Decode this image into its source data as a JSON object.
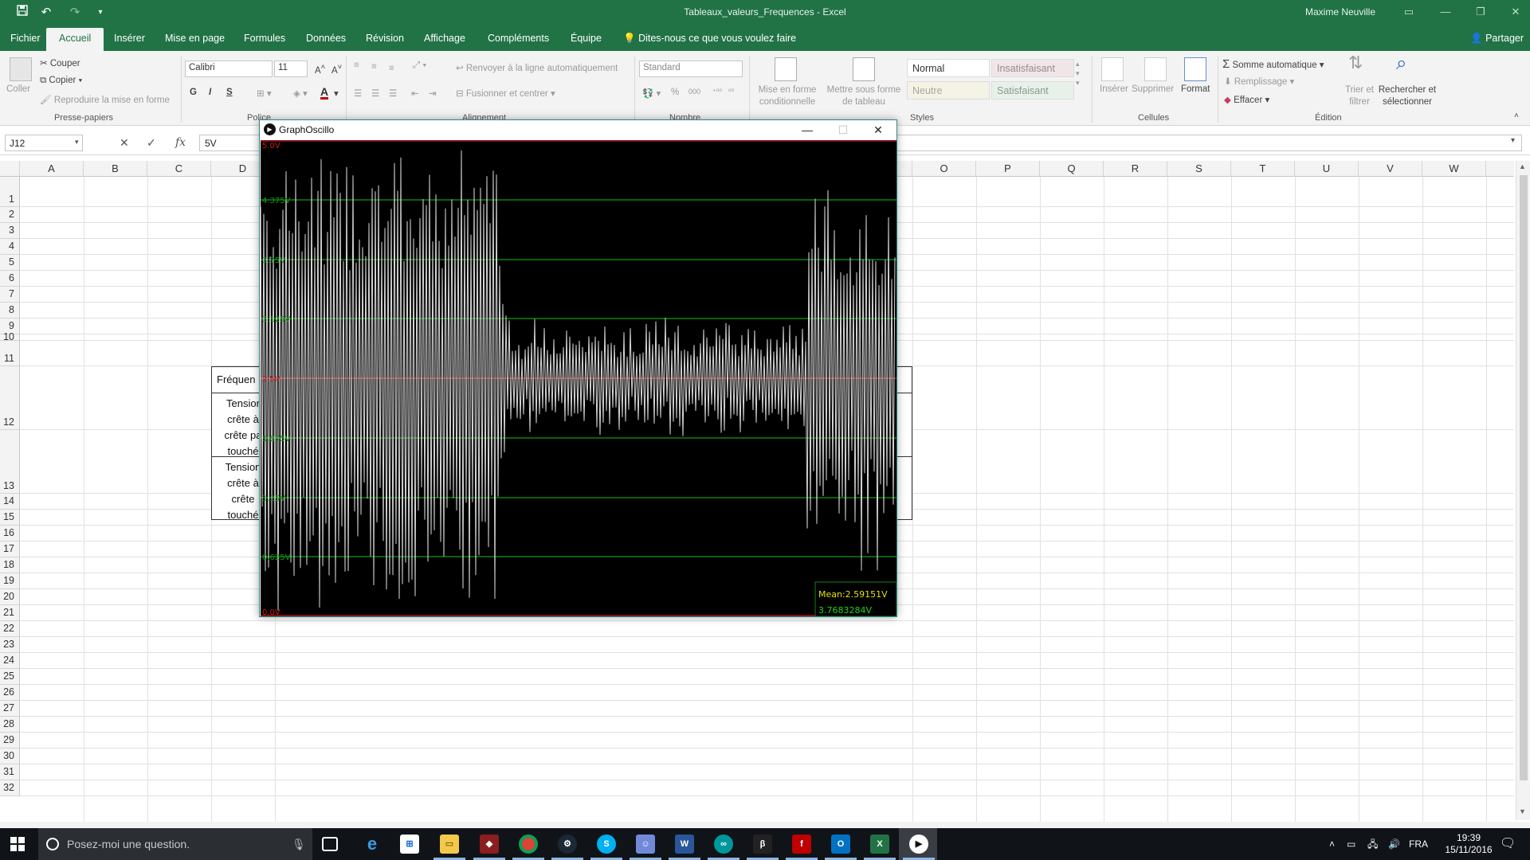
{
  "app": {
    "title": "Tableaux_valeurs_Frequences - Excel",
    "user": "Maxime Neuville",
    "share_label": "Partager",
    "accent": "#217346"
  },
  "quick_access": {
    "save_icon": "save-icon",
    "undo_icon": "undo-icon",
    "redo_icon": "redo-icon",
    "customize_icon": "customize-icon"
  },
  "tabs": [
    "Fichier",
    "Accueil",
    "Insérer",
    "Mise en page",
    "Formules",
    "Données",
    "Révision",
    "Affichage",
    "Compléments",
    "Équipe"
  ],
  "tell_me": "Dites-nous ce que vous voulez faire",
  "ribbon": {
    "clipboard": {
      "paste": "Coller",
      "cut": "Couper",
      "copy": "Copier",
      "format_painter": "Reproduire la mise en forme",
      "group": "Presse-papiers"
    },
    "font": {
      "name": "Calibri",
      "size": "11",
      "group": "Police",
      "bold": "G",
      "italic": "I",
      "underline": "S",
      "color": "#c00000"
    },
    "alignment": {
      "wrap": "Renvoyer à la ligne automatiquement",
      "merge": "Fusionner et centrer",
      "group": "Alignement"
    },
    "number": {
      "format": "Standard",
      "percent": "%",
      "thousands": "000",
      "group": "Nombre"
    },
    "styles": {
      "conditional": "Mise en forme conditionnelle",
      "as_table": "Mettre sous forme de tableau",
      "normal": "Normal",
      "bad": "Insatisfaisant",
      "neutral": "Neutre",
      "good": "Satisfaisant",
      "group": "Styles",
      "bad_color": "#ffc7ce",
      "good_color": "#c6efce",
      "neutral_color": "#ffeb9c"
    },
    "cells": {
      "insert": "Insérer",
      "delete": "Supprimer",
      "format": "Format",
      "group": "Cellules"
    },
    "editing": {
      "autosum": "Somme automatique",
      "fill": "Remplissage",
      "clear": "Effacer",
      "sort": "Trier et filtrer",
      "find": "Rechercher et sélectionner",
      "group": "Édition"
    }
  },
  "formula_bar": {
    "name_box": "J12",
    "value": "5V",
    "fx": "fx"
  },
  "grid": {
    "columns": [
      "A",
      "B",
      "C",
      "D",
      "O",
      "P",
      "Q",
      "R",
      "S",
      "T",
      "U",
      "V",
      "W"
    ],
    "rows": [
      "1",
      "2",
      "3",
      "4",
      "5",
      "6",
      "7",
      "8",
      "9",
      "10",
      "11",
      "12",
      "13",
      "14",
      "15",
      "16",
      "17",
      "18",
      "19",
      "20",
      "21",
      "22",
      "23",
      "24",
      "25",
      "26",
      "27",
      "28",
      "29",
      "30",
      "31",
      "32"
    ],
    "table_cells": {
      "r11": "Fréquen",
      "r12": [
        "Tensior",
        "crête à",
        "crête pa",
        "touché"
      ],
      "r13": [
        "Tension",
        "crête à",
        "crête",
        "touché"
      ]
    }
  },
  "oscillo": {
    "title": "GraphOscillo",
    "labels": [
      "5.0V",
      "4.375V",
      "3.75V",
      "3.125V",
      "2.5V",
      "1.875V",
      "1.25V",
      "0.625V",
      "0.0V"
    ],
    "mean": "Mean:2.59151V",
    "current": "3.7683284V"
  },
  "taskbar": {
    "search_placeholder": "Posez-moi une question.",
    "lang": "FRA",
    "time": "19:39",
    "date": "15/11/2016",
    "apps": [
      "task-view",
      "edge",
      "store",
      "explorer",
      "media",
      "chrome",
      "steam",
      "skype",
      "discord",
      "word",
      "arduino",
      "bittorrent",
      "filezilla",
      "outlook",
      "excel",
      "processing"
    ]
  }
}
